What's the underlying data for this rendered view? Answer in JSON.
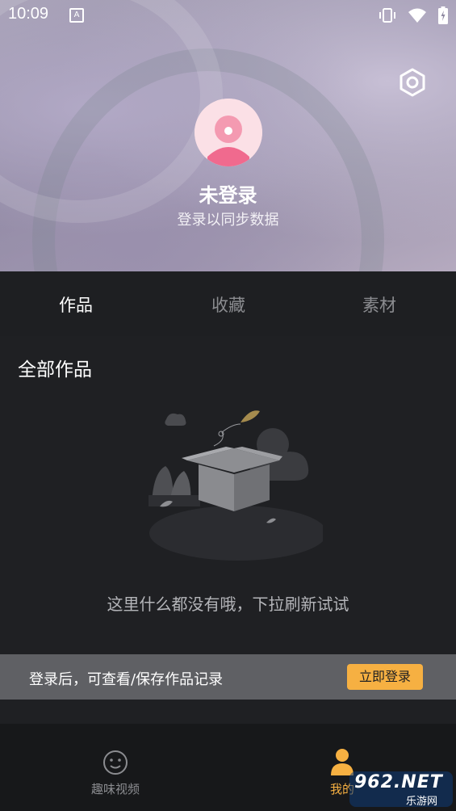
{
  "status_bar": {
    "time": "10:09",
    "notification_letter": "A",
    "icons": [
      "vibrate-icon",
      "wifi-icon",
      "battery-icon"
    ]
  },
  "profile": {
    "title": "未登录",
    "subtitle": "登录以同步数据"
  },
  "tabs": [
    {
      "label": "作品",
      "active": true
    },
    {
      "label": "收藏",
      "active": false
    },
    {
      "label": "素材",
      "active": false
    }
  ],
  "section": {
    "title": "全部作品"
  },
  "empty_state": {
    "message": "这里什么都没有哦，下拉刷新试试"
  },
  "banner": {
    "text": "登录后，可查看/保存作品记录",
    "button": "立即登录"
  },
  "bottom_nav": [
    {
      "label": "趣味视频",
      "active": false,
      "icon": "smiley-icon"
    },
    {
      "label": "我的",
      "active": true,
      "icon": "user-icon"
    }
  ],
  "watermark": {
    "text": "962.NET",
    "subtext": "乐游网"
  },
  "colors": {
    "accent": "#f6b042",
    "background": "#1f2023",
    "banner": "#5f6064"
  }
}
